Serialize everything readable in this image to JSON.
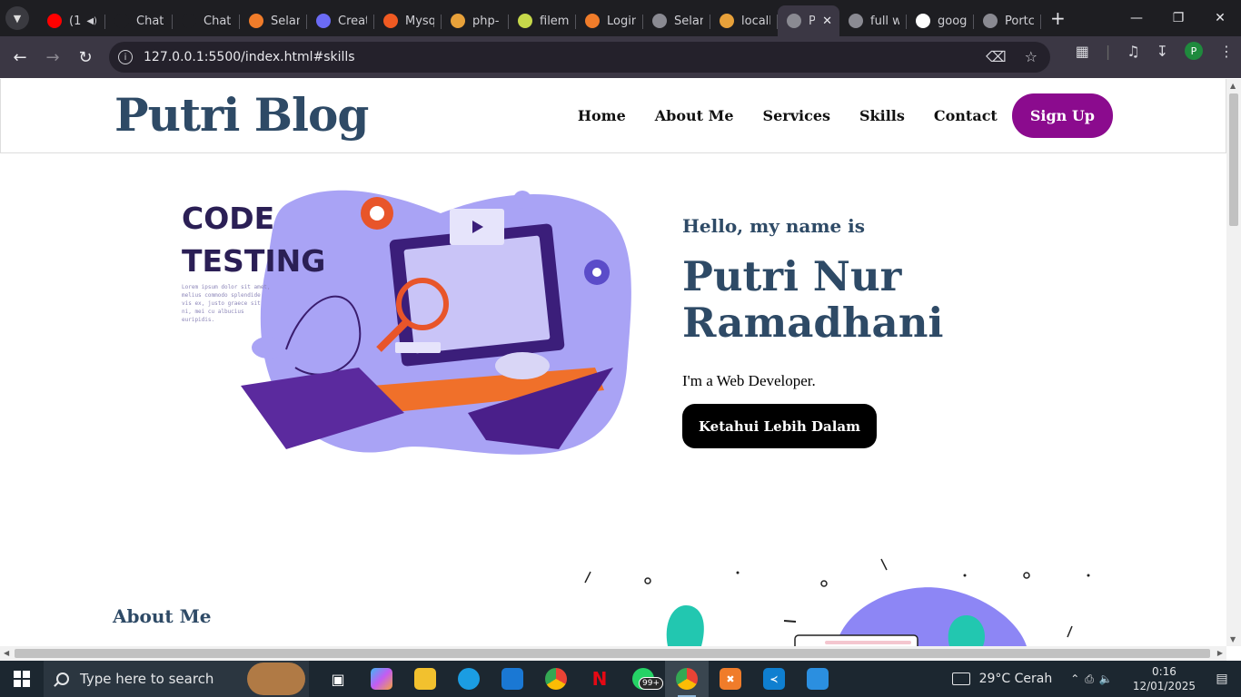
{
  "browser": {
    "tabs": [
      {
        "title": "(1",
        "favicon": "youtube-icon",
        "color": "#ff0000"
      },
      {
        "title": "Chat",
        "favicon": "chatgpt-icon",
        "color": "#1e1e22"
      },
      {
        "title": "Chat",
        "favicon": "chatgpt-icon",
        "color": "#1e1e22"
      },
      {
        "title": "Selan",
        "favicon": "xampp-icon",
        "color": "#f07c2a"
      },
      {
        "title": "Creat",
        "favicon": "meta-icon",
        "color": "#6b6bf5"
      },
      {
        "title": "Mysq",
        "favicon": "ddl-icon",
        "color": "#f05a22"
      },
      {
        "title": "php-",
        "favicon": "phpmyadmin-icon",
        "color": "#e8a13a"
      },
      {
        "title": "filem",
        "favicon": "flask-icon",
        "color": "#c6d84a"
      },
      {
        "title": "Login",
        "favicon": "xampp-icon",
        "color": "#f07c2a"
      },
      {
        "title": "Selan",
        "favicon": "globe-icon",
        "color": "#8a8a92"
      },
      {
        "title": "locall",
        "favicon": "phpmyadmin-icon",
        "color": "#e8a13a"
      },
      {
        "title": "P",
        "favicon": "globe-icon",
        "color": "#8a8a92",
        "active": true
      },
      {
        "title": "full w",
        "favicon": "globe-icon",
        "color": "#8a8a92"
      },
      {
        "title": "goog",
        "favicon": "google-icon",
        "color": "#ffffff"
      },
      {
        "title": "Portc",
        "favicon": "globe-icon",
        "color": "#8a8a92"
      }
    ],
    "url": "127.0.0.1:5500/index.html#skills",
    "profile_initial": "P"
  },
  "site": {
    "logo": "Putri Blog",
    "nav": [
      "Home",
      "About Me",
      "Services",
      "Skills",
      "Contact"
    ],
    "signup": "Sign Up",
    "hero": {
      "image_text": "CODE TESTING",
      "image_caption": "Lorem ipsum dolor sit amet, melius commodo splendide vis ex, justo graece sit ni, mei cu albucius euripidis.",
      "greeting": "Hello, my name is",
      "name": "Putri Nur Ramadhani",
      "role": "I'm a Web Developer.",
      "cta": "Ketahui Lebih Dalam"
    },
    "about_heading": "About Me"
  },
  "taskbar": {
    "search_placeholder": "Type here to search",
    "whatsapp_badge": "99+",
    "weather": "29°C  Cerah",
    "time": "0:16",
    "date": "12/01/2025"
  },
  "colors": {
    "brand": "#2e4a66",
    "signup": "#8b0b8e",
    "cta": "#000000"
  }
}
